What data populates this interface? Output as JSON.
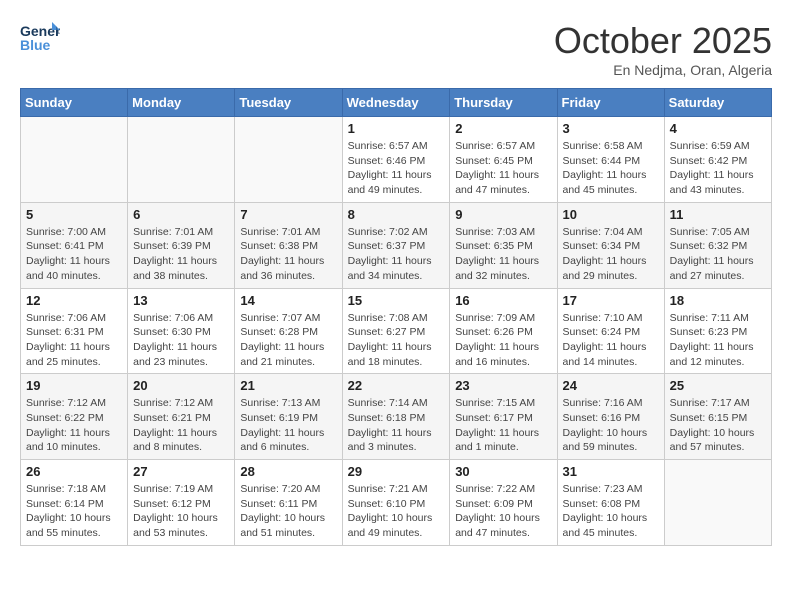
{
  "logo": {
    "line1": "General",
    "line2": "Blue"
  },
  "title": "October 2025",
  "subtitle": "En Nedjma, Oran, Algeria",
  "weekdays": [
    "Sunday",
    "Monday",
    "Tuesday",
    "Wednesday",
    "Thursday",
    "Friday",
    "Saturday"
  ],
  "weeks": [
    [
      {
        "day": "",
        "info": ""
      },
      {
        "day": "",
        "info": ""
      },
      {
        "day": "",
        "info": ""
      },
      {
        "day": "1",
        "info": "Sunrise: 6:57 AM\nSunset: 6:46 PM\nDaylight: 11 hours\nand 49 minutes."
      },
      {
        "day": "2",
        "info": "Sunrise: 6:57 AM\nSunset: 6:45 PM\nDaylight: 11 hours\nand 47 minutes."
      },
      {
        "day": "3",
        "info": "Sunrise: 6:58 AM\nSunset: 6:44 PM\nDaylight: 11 hours\nand 45 minutes."
      },
      {
        "day": "4",
        "info": "Sunrise: 6:59 AM\nSunset: 6:42 PM\nDaylight: 11 hours\nand 43 minutes."
      }
    ],
    [
      {
        "day": "5",
        "info": "Sunrise: 7:00 AM\nSunset: 6:41 PM\nDaylight: 11 hours\nand 40 minutes."
      },
      {
        "day": "6",
        "info": "Sunrise: 7:01 AM\nSunset: 6:39 PM\nDaylight: 11 hours\nand 38 minutes."
      },
      {
        "day": "7",
        "info": "Sunrise: 7:01 AM\nSunset: 6:38 PM\nDaylight: 11 hours\nand 36 minutes."
      },
      {
        "day": "8",
        "info": "Sunrise: 7:02 AM\nSunset: 6:37 PM\nDaylight: 11 hours\nand 34 minutes."
      },
      {
        "day": "9",
        "info": "Sunrise: 7:03 AM\nSunset: 6:35 PM\nDaylight: 11 hours\nand 32 minutes."
      },
      {
        "day": "10",
        "info": "Sunrise: 7:04 AM\nSunset: 6:34 PM\nDaylight: 11 hours\nand 29 minutes."
      },
      {
        "day": "11",
        "info": "Sunrise: 7:05 AM\nSunset: 6:32 PM\nDaylight: 11 hours\nand 27 minutes."
      }
    ],
    [
      {
        "day": "12",
        "info": "Sunrise: 7:06 AM\nSunset: 6:31 PM\nDaylight: 11 hours\nand 25 minutes."
      },
      {
        "day": "13",
        "info": "Sunrise: 7:06 AM\nSunset: 6:30 PM\nDaylight: 11 hours\nand 23 minutes."
      },
      {
        "day": "14",
        "info": "Sunrise: 7:07 AM\nSunset: 6:28 PM\nDaylight: 11 hours\nand 21 minutes."
      },
      {
        "day": "15",
        "info": "Sunrise: 7:08 AM\nSunset: 6:27 PM\nDaylight: 11 hours\nand 18 minutes."
      },
      {
        "day": "16",
        "info": "Sunrise: 7:09 AM\nSunset: 6:26 PM\nDaylight: 11 hours\nand 16 minutes."
      },
      {
        "day": "17",
        "info": "Sunrise: 7:10 AM\nSunset: 6:24 PM\nDaylight: 11 hours\nand 14 minutes."
      },
      {
        "day": "18",
        "info": "Sunrise: 7:11 AM\nSunset: 6:23 PM\nDaylight: 11 hours\nand 12 minutes."
      }
    ],
    [
      {
        "day": "19",
        "info": "Sunrise: 7:12 AM\nSunset: 6:22 PM\nDaylight: 11 hours\nand 10 minutes."
      },
      {
        "day": "20",
        "info": "Sunrise: 7:12 AM\nSunset: 6:21 PM\nDaylight: 11 hours\nand 8 minutes."
      },
      {
        "day": "21",
        "info": "Sunrise: 7:13 AM\nSunset: 6:19 PM\nDaylight: 11 hours\nand 6 minutes."
      },
      {
        "day": "22",
        "info": "Sunrise: 7:14 AM\nSunset: 6:18 PM\nDaylight: 11 hours\nand 3 minutes."
      },
      {
        "day": "23",
        "info": "Sunrise: 7:15 AM\nSunset: 6:17 PM\nDaylight: 11 hours\nand 1 minute."
      },
      {
        "day": "24",
        "info": "Sunrise: 7:16 AM\nSunset: 6:16 PM\nDaylight: 10 hours\nand 59 minutes."
      },
      {
        "day": "25",
        "info": "Sunrise: 7:17 AM\nSunset: 6:15 PM\nDaylight: 10 hours\nand 57 minutes."
      }
    ],
    [
      {
        "day": "26",
        "info": "Sunrise: 7:18 AM\nSunset: 6:14 PM\nDaylight: 10 hours\nand 55 minutes."
      },
      {
        "day": "27",
        "info": "Sunrise: 7:19 AM\nSunset: 6:12 PM\nDaylight: 10 hours\nand 53 minutes."
      },
      {
        "day": "28",
        "info": "Sunrise: 7:20 AM\nSunset: 6:11 PM\nDaylight: 10 hours\nand 51 minutes."
      },
      {
        "day": "29",
        "info": "Sunrise: 7:21 AM\nSunset: 6:10 PM\nDaylight: 10 hours\nand 49 minutes."
      },
      {
        "day": "30",
        "info": "Sunrise: 7:22 AM\nSunset: 6:09 PM\nDaylight: 10 hours\nand 47 minutes."
      },
      {
        "day": "31",
        "info": "Sunrise: 7:23 AM\nSunset: 6:08 PM\nDaylight: 10 hours\nand 45 minutes."
      },
      {
        "day": "",
        "info": ""
      }
    ]
  ]
}
